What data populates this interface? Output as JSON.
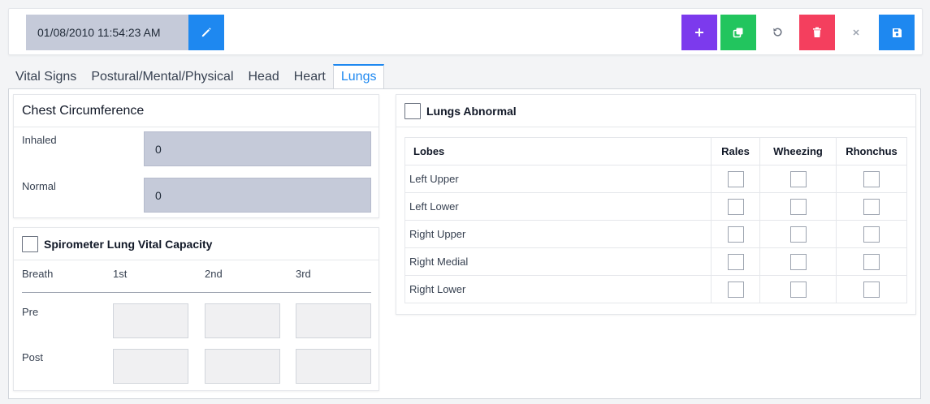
{
  "toolbar": {
    "datetime": "01/08/2010 11:54:23 AM",
    "buttons": {
      "edit": {
        "icon": "pencil-icon",
        "color": "#1e88f0"
      },
      "add": {
        "icon": "plus-icon",
        "color": "#7c3aed"
      },
      "copy": {
        "icon": "copy-icon",
        "color": "#22c55e"
      },
      "undo": {
        "icon": "undo-icon"
      },
      "delete": {
        "icon": "trash-icon",
        "color": "#f43f5e"
      },
      "close": {
        "icon": "close-icon"
      },
      "save": {
        "icon": "save-icon",
        "color": "#1e88f0"
      }
    }
  },
  "tabs": [
    {
      "label": "Vital Signs",
      "active": false
    },
    {
      "label": "Postural/Mental/Physical",
      "active": false
    },
    {
      "label": "Head",
      "active": false
    },
    {
      "label": "Heart",
      "active": false
    },
    {
      "label": "Lungs",
      "active": true
    }
  ],
  "chest": {
    "title": "Chest Circumference",
    "inhaled_label": "Inhaled",
    "inhaled_value": "0",
    "normal_label": "Normal",
    "normal_value": "0"
  },
  "spirometer": {
    "title": "Spirometer Lung Vital Capacity",
    "checked": false,
    "columns": [
      "Breath",
      "1st",
      "2nd",
      "3rd"
    ],
    "rows": [
      {
        "label": "Pre",
        "values": [
          "",
          "",
          ""
        ]
      },
      {
        "label": "Post",
        "values": [
          "",
          "",
          ""
        ]
      }
    ]
  },
  "lungs": {
    "title": "Lungs Abnormal",
    "checked": false,
    "headers": [
      "Lobes",
      "Rales",
      "Wheezing",
      "Rhonchus"
    ],
    "rows": [
      {
        "lobe": "Left Upper",
        "rales": false,
        "wheezing": false,
        "rhonchus": false
      },
      {
        "lobe": "Left Lower",
        "rales": false,
        "wheezing": false,
        "rhonchus": false
      },
      {
        "lobe": "Right Upper",
        "rales": false,
        "wheezing": false,
        "rhonchus": false
      },
      {
        "lobe": "Right Medial",
        "rales": false,
        "wheezing": false,
        "rhonchus": false
      },
      {
        "lobe": "Right Lower",
        "rales": false,
        "wheezing": false,
        "rhonchus": false
      }
    ]
  },
  "colors": {
    "accent": "#1e88f0",
    "input_fill": "#c5cad9"
  }
}
